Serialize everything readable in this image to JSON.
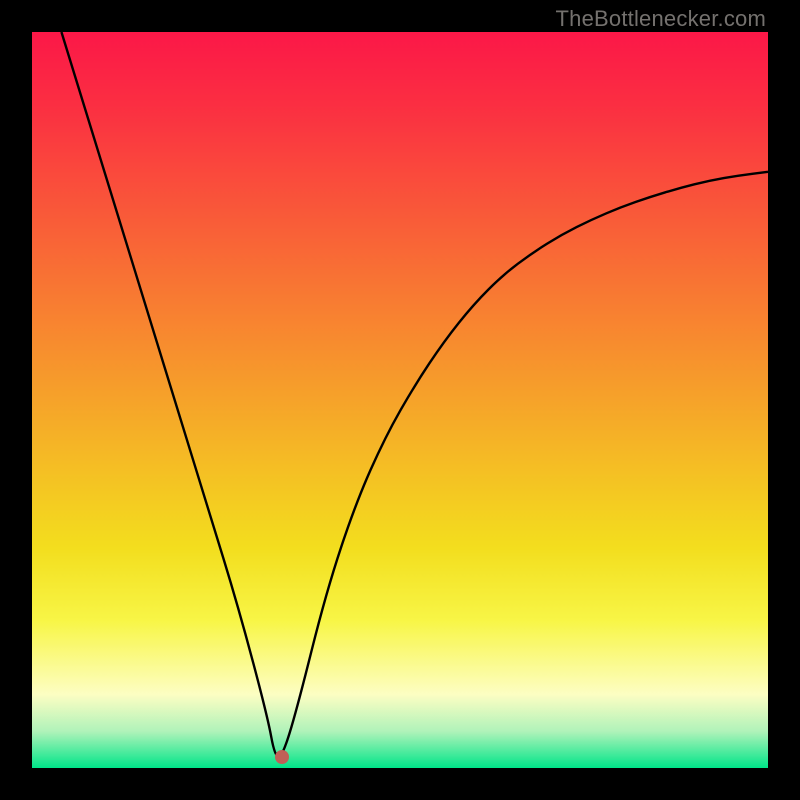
{
  "watermark": "TheBottlenecker.com",
  "colors": {
    "black": "#000000",
    "marker_fill": "#c06057",
    "curve_stroke": "#000000",
    "gradient_stops": [
      {
        "offset": 0.0,
        "color": "#fc1848"
      },
      {
        "offset": 0.1,
        "color": "#fb2f42"
      },
      {
        "offset": 0.2,
        "color": "#fa4c3c"
      },
      {
        "offset": 0.3,
        "color": "#f96936"
      },
      {
        "offset": 0.4,
        "color": "#f88630"
      },
      {
        "offset": 0.5,
        "color": "#f6a32a"
      },
      {
        "offset": 0.6,
        "color": "#f5c124"
      },
      {
        "offset": 0.7,
        "color": "#f3de1e"
      },
      {
        "offset": 0.8,
        "color": "#f8f647"
      },
      {
        "offset": 0.9,
        "color": "#fdfec3"
      },
      {
        "offset": 0.95,
        "color": "#b1f3ba"
      },
      {
        "offset": 1.0,
        "color": "#00e589"
      }
    ]
  },
  "chart_data": {
    "type": "line",
    "title": "",
    "xlabel": "",
    "ylabel": "",
    "xlim": [
      0,
      100
    ],
    "ylim": [
      0,
      100
    ],
    "x": [
      4,
      8,
      12,
      16,
      20,
      24,
      28,
      32,
      33,
      34,
      36,
      40,
      44,
      48,
      52,
      56,
      60,
      64,
      68,
      72,
      76,
      80,
      84,
      88,
      92,
      96,
      100
    ],
    "values": [
      100,
      87,
      74,
      61,
      48,
      35,
      22,
      7,
      1.5,
      1.5,
      8,
      24,
      36,
      45,
      52,
      58,
      63,
      67,
      70,
      72.5,
      74.5,
      76.2,
      77.6,
      78.8,
      79.8,
      80.5,
      81
    ],
    "marker": {
      "x": 34,
      "y": 1.5
    },
    "grid": false,
    "legend": false
  }
}
